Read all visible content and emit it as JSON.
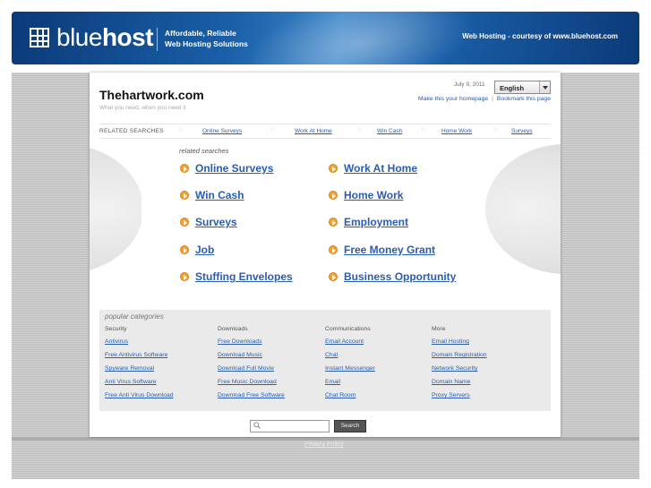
{
  "header": {
    "logo_light": "blue",
    "logo_bold": "host",
    "tagline_line1": "Affordable, Reliable",
    "tagline_line2": "Web Hosting Solutions",
    "courtesy": "Web Hosting - courtesy of www.bluehost.com"
  },
  "site": {
    "title": "Thehartwork.com",
    "subtitle": "What you need, when you need it",
    "date": "July 9, 2011",
    "language": "English",
    "make_homepage": "Make this your homepage",
    "separator": "|",
    "bookmark": "Bookmark this page"
  },
  "related_bar": {
    "label": "RELATED SEARCHES",
    "items": [
      "Online Surveys",
      "Work At Home",
      "Win Cash",
      "Home Work",
      "Surveys"
    ]
  },
  "related_searches": {
    "label": "related searches",
    "left": [
      "Online Surveys",
      "Win Cash",
      "Surveys",
      "Job",
      "Stuffing Envelopes"
    ],
    "right": [
      "Work At Home",
      "Home Work",
      "Employment",
      "Free Money Grant",
      "Business Opportunity"
    ]
  },
  "popular": {
    "title": "popular categories",
    "columns": [
      {
        "head": "Security",
        "links": [
          "Antivirus",
          "Free Antivirus Software",
          "Spyware Removal",
          "Anti Virus Software",
          "Free Anti Virus Download"
        ]
      },
      {
        "head": "Downloads",
        "links": [
          "Free Downloads",
          "Download Music",
          "Download Full Movie",
          "Free Music Download",
          "Download Free Software"
        ]
      },
      {
        "head": "Communications",
        "links": [
          "Email Account",
          "Chat",
          "Instant Messenger",
          "Email",
          "Chat Room"
        ]
      },
      {
        "head": "More",
        "links": [
          "Email Hosting",
          "Domain Registration",
          "Network Security",
          "Domain Name",
          "Proxy Servers"
        ]
      }
    ]
  },
  "search": {
    "placeholder": "",
    "button": "Search"
  },
  "footer": {
    "privacy": "Privacy Policy"
  },
  "colors": {
    "link": "#2a5db0",
    "header_blue": "#1a5fa8",
    "arrow_orange": "#f0a238"
  }
}
